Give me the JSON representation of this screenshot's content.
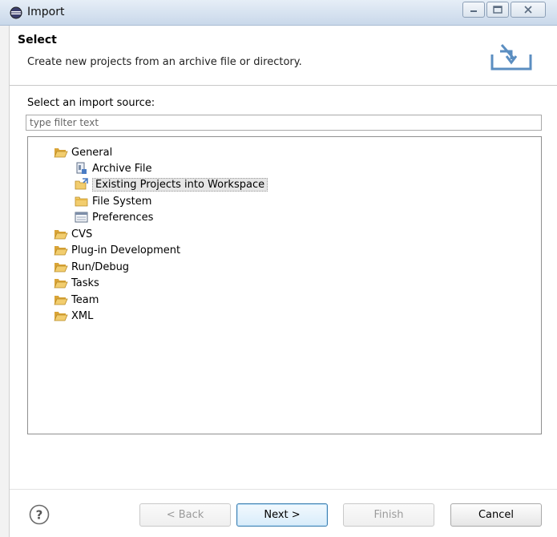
{
  "window": {
    "title": "Import",
    "icon": "eclipse-icon"
  },
  "banner": {
    "title": "Select",
    "description": "Create new projects from an archive file or directory."
  },
  "source": {
    "label": "Select an import source:",
    "filter_placeholder": "type filter text"
  },
  "tree": [
    {
      "label": "General",
      "icon": "folder-open-icon",
      "level": 0
    },
    {
      "label": "Archive File",
      "icon": "archive-file-icon",
      "level": 1
    },
    {
      "label": "Existing Projects into Workspace",
      "icon": "project-import-icon",
      "level": 1,
      "selected": true
    },
    {
      "label": "File System",
      "icon": "folder-closed-icon",
      "level": 1
    },
    {
      "label": "Preferences",
      "icon": "preferences-icon",
      "level": 1
    },
    {
      "label": "CVS",
      "icon": "folder-open-icon",
      "level": 0
    },
    {
      "label": "Plug-in Development",
      "icon": "folder-open-icon",
      "level": 0
    },
    {
      "label": "Run/Debug",
      "icon": "folder-open-icon",
      "level": 0
    },
    {
      "label": "Tasks",
      "icon": "folder-open-icon",
      "level": 0
    },
    {
      "label": "Team",
      "icon": "folder-open-icon",
      "level": 0
    },
    {
      "label": "XML",
      "icon": "folder-open-icon",
      "level": 0
    }
  ],
  "buttons": {
    "help": "?",
    "back": "< Back",
    "next": "Next >",
    "finish": "Finish",
    "cancel": "Cancel"
  },
  "colors": {
    "folder": "#e8b84a",
    "selection": "#e6e6e6",
    "default_button_border": "#3c7fb1"
  }
}
